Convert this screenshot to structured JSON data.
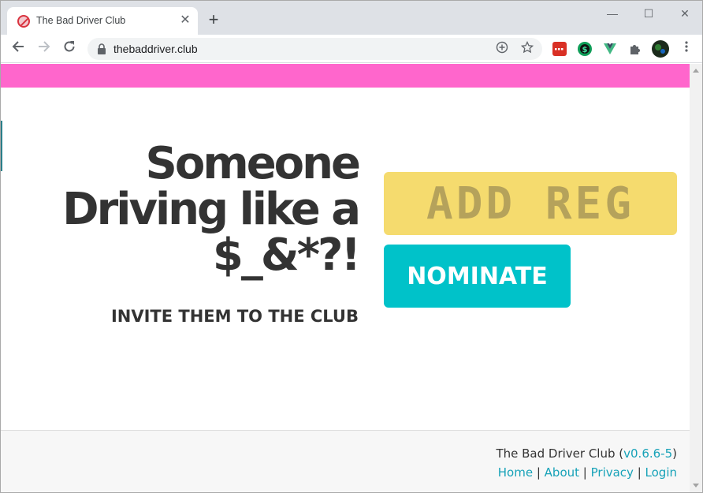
{
  "browser": {
    "tab_title": "The Bad Driver Club",
    "url": "thebaddriver.club",
    "new_tab_symbol": "+",
    "close_symbol": "✕",
    "minimize_symbol": "—",
    "maximize_symbol": "☐",
    "window_close_symbol": "✕",
    "icons": [
      "back-icon",
      "forward-icon",
      "reload-icon",
      "lock-icon",
      "add-to-page-icon",
      "star-icon",
      "extensions-puzzle-icon",
      "menu-dots-icon"
    ]
  },
  "page": {
    "accent_color": "#ff66cc",
    "headline_lines": [
      "Someone",
      "Driving like a",
      "$_&*?!"
    ],
    "subline": "INVITE THEM TO THE CLUB",
    "reg_placeholder": "ADD REG",
    "nominate_label": "NOMINATE",
    "reg_color": "#f5db6e",
    "button_color": "#00c2c9"
  },
  "footer": {
    "club_name": "The Bad Driver Club",
    "version_open": " (",
    "version": "v0.6.6-5",
    "version_close": ")",
    "links": [
      "Home",
      "About",
      "Privacy",
      "Login"
    ],
    "separator": " | "
  }
}
